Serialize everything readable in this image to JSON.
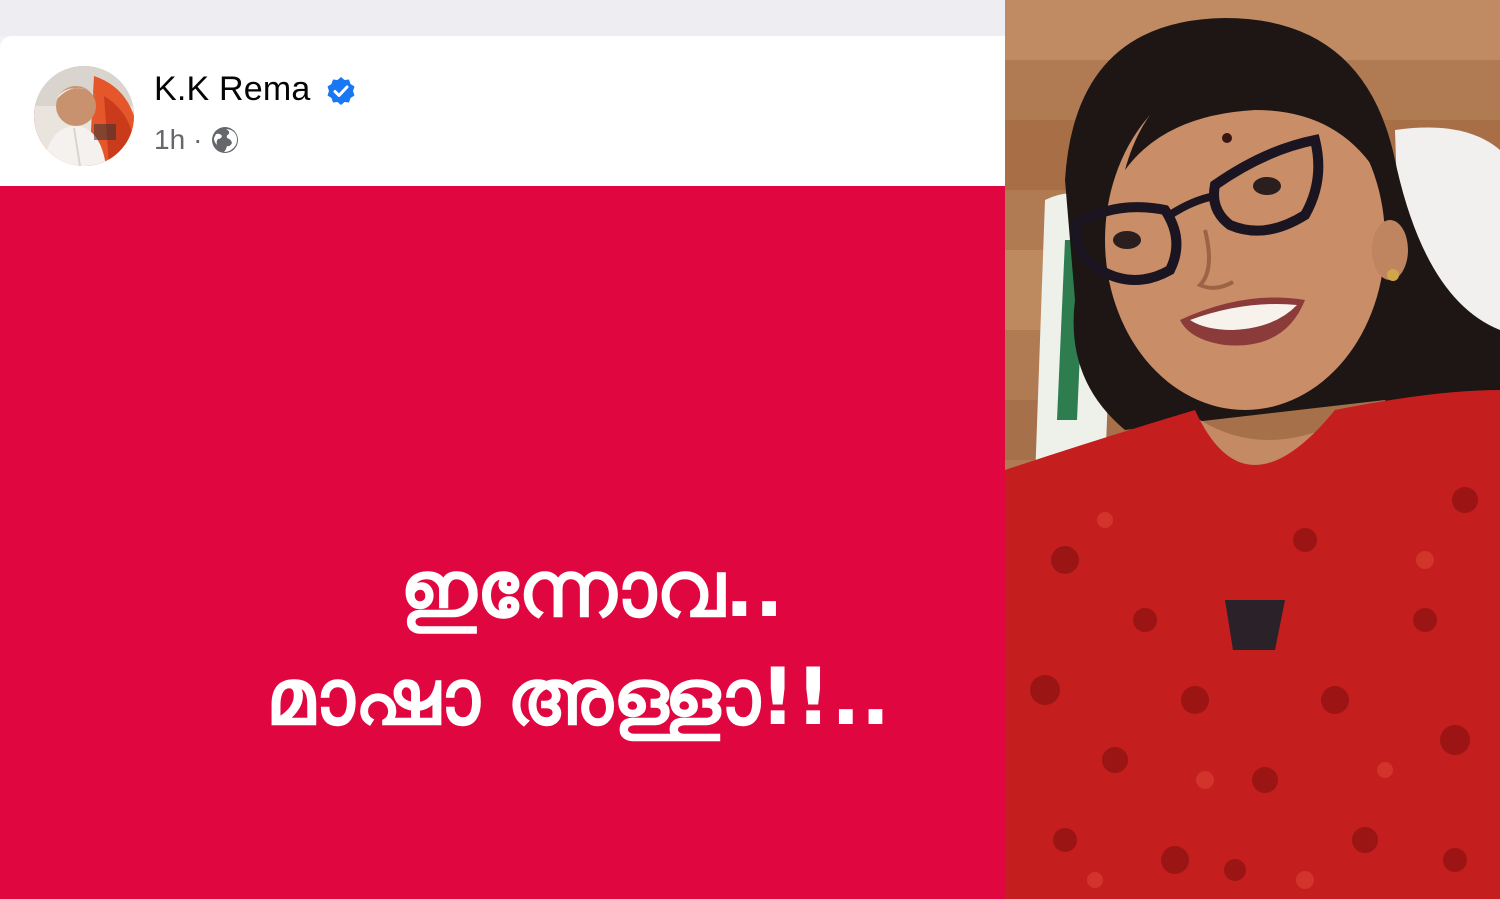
{
  "post": {
    "author_name": "K.K Rema",
    "time": "1h",
    "time_separator": "·",
    "audience_icon": "globe-icon",
    "verified_icon": "verified-badge-icon",
    "body_lines": [
      "ഇന്നോവ..",
      "മാഷാ അള്ളാ!!.."
    ],
    "background_color": "#e0063f",
    "text_color": "#ffffff"
  },
  "photo": {
    "subject": "smiling woman with glasses and red scarf"
  },
  "colors": {
    "verified": "#1877f2",
    "meta_text": "#65676b",
    "name_text": "#050505"
  }
}
